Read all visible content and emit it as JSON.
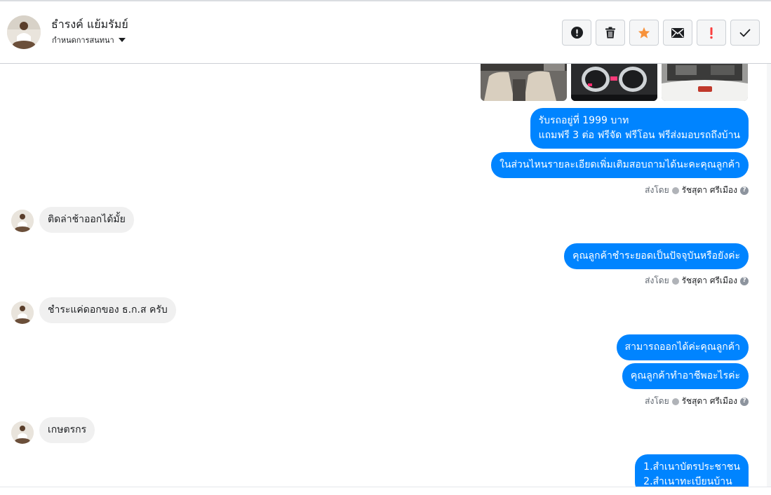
{
  "header": {
    "contact_name": "ธำรงค์ แย้มรัมย์",
    "label_dropdown": "กำหนดการสนทนา",
    "toolbar": [
      {
        "name": "report-spam-button",
        "icon": "alert-circle-icon",
        "color": "#1c1e21"
      },
      {
        "name": "delete-button",
        "icon": "trash-icon",
        "color": "#1c1e21"
      },
      {
        "name": "star-button",
        "icon": "star-icon",
        "color": "#f7923b"
      },
      {
        "name": "mark-unread-button",
        "icon": "envelope-icon",
        "color": "#1c1e21"
      },
      {
        "name": "follow-up-button",
        "icon": "exclamation-icon",
        "color": "#fa3e3e"
      },
      {
        "name": "mark-done-button",
        "icon": "check-icon",
        "color": "#1c1e21"
      }
    ]
  },
  "thread": {
    "attachments": [
      "car-interior-photo",
      "car-dashboard-photo",
      "car-engine-photo"
    ],
    "msg1_line1": "รับรถอยู่ที่ 1999 บาท",
    "msg1_line2": "แถมฟรี 3 ต่อ ฟรีจัด ฟรีโอน  ฟรีส่งมอบรถถึงบ้าน",
    "msg2": "ในส่วนไหนรายละเอียดเพิ่มเติมสอบถามได้นะคะคุณลูกค้า",
    "sent_by_label": "ส่งโดย",
    "agent_name": "รัชสุดา ศรีเมือง",
    "in1": "ติดล่าช้าออกได้มั้ย",
    "msg3": "คุณลูกค้าชำระยอดเป็นปัจจุบันหรือยังค่ะ",
    "in2": "ชำระแค่ดอกของ  ธ.ก.ส  ครับ",
    "msg4": "สามารถออกได้ค่ะคุณลูกค้า",
    "msg5": "คุณลูกค้าทำอาชีพอะไรค่ะ",
    "in3": "เกษตรกร",
    "msg6_line1": "1.สำเนาบัตรประชาชน",
    "msg6_line2": "2.สำเนาทะเบียนบ้าน"
  },
  "colors": {
    "outgoing_bubble": "#0084ff",
    "incoming_bubble": "#f0f0f0",
    "star": "#f7923b",
    "follow_up": "#fa3e3e"
  }
}
